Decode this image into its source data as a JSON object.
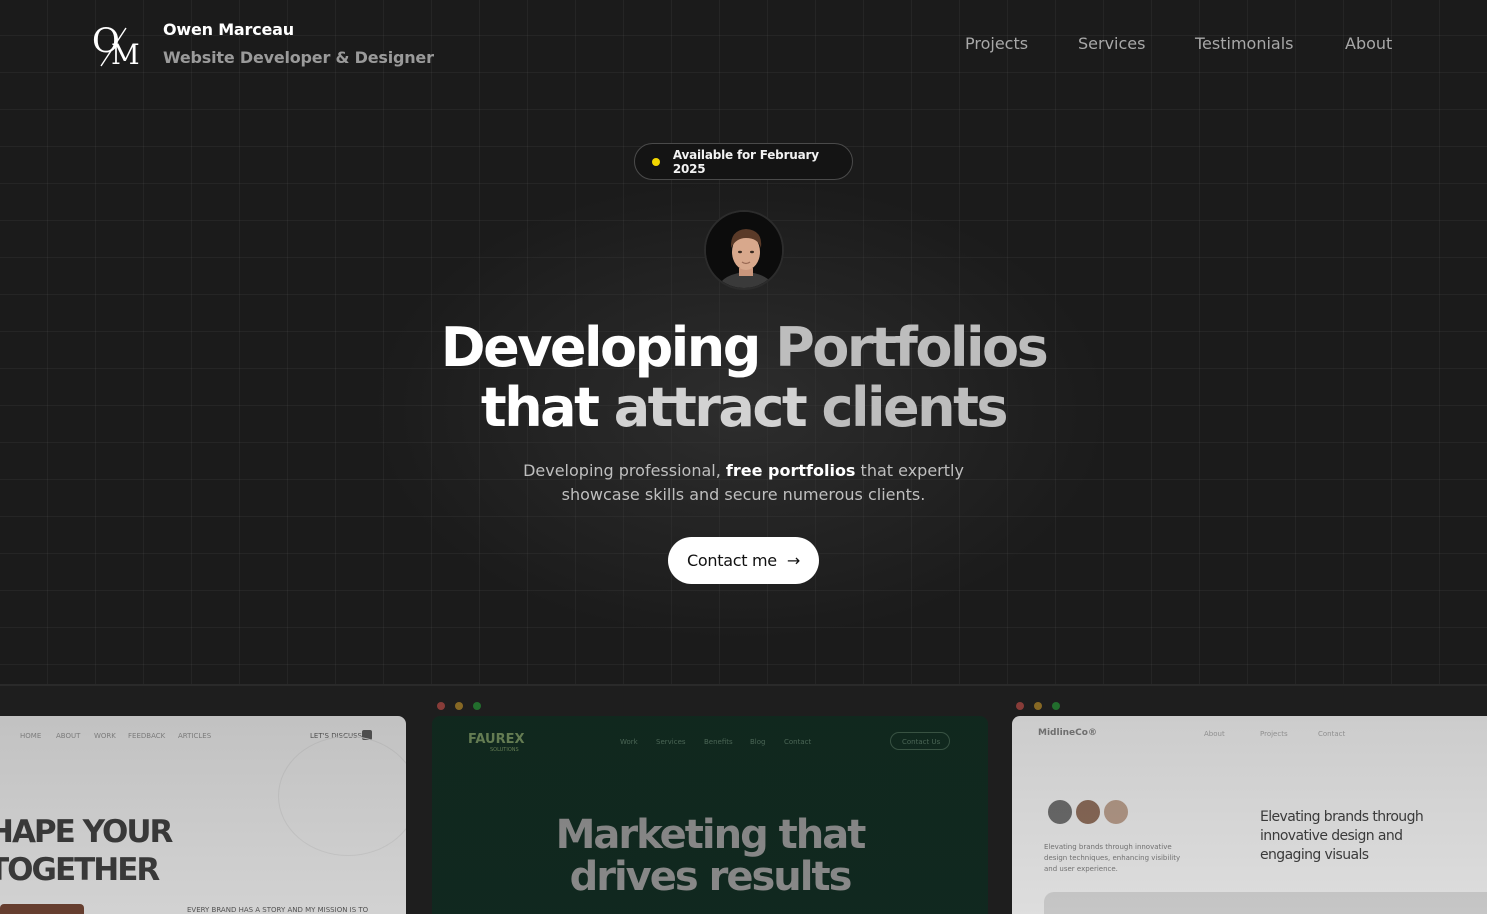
{
  "header": {
    "logo_text": "OM",
    "name": "Owen Marceau",
    "role": "Website Developer & Designer",
    "nav": [
      {
        "label": "Projects"
      },
      {
        "label": "Services"
      },
      {
        "label": "Testimonials"
      },
      {
        "label": "About"
      }
    ]
  },
  "hero": {
    "badge": "Available for February 2025",
    "headline_line1_a": "Developing",
    "headline_line1_b": "Portfolios",
    "headline_line2_a": "that",
    "headline_line2_b": "attract",
    "headline_line2_c": "clients",
    "sub_line1_a": "Developing professional,",
    "sub_line1_b": "free portfolios",
    "sub_line1_c": "that expertly",
    "sub_line2": "showcase skills and secure numerous clients.",
    "cta": "Contact me",
    "cta_icon": "arrow-right-icon"
  },
  "showcase": {
    "card_a": {
      "nav": [
        "HOME",
        "ABOUT",
        "WORK",
        "FEEDBACK",
        "ARTICLES"
      ],
      "nav_cta": "LET'S DISCUSS",
      "headline_1": "HAPE YOUR",
      "headline_2": "TOGETHER",
      "caption": "EVERY BRAND HAS A STORY AND MY MISSION IS TO"
    },
    "card_b": {
      "brand": "FAUREX",
      "brand_sub": "SOLUTIONS",
      "nav": [
        "Work",
        "Services",
        "Benefits",
        "Blog",
        "Contact"
      ],
      "nav_cta": "Contact Us",
      "headline_1": "Marketing that",
      "headline_2": "drives results"
    },
    "card_c": {
      "brand": "MidlineCo®",
      "nav": [
        "About",
        "Projects",
        "Contact"
      ],
      "small_text": "Elevating brands through innovative design techniques, enhancing visibility and user experience.",
      "headline_1": "Elevating brands through",
      "headline_2": "innovative design and",
      "headline_3": "engaging visuals"
    }
  },
  "colors": {
    "background": "#1b1b1b",
    "badge_dot": "#f2d600",
    "cta_bg": "#ffffff",
    "card_green": "#0f2a1f"
  }
}
